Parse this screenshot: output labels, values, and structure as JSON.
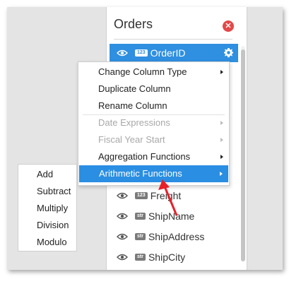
{
  "panel": {
    "title": "Orders",
    "close_icon": "close-icon",
    "fields": [
      {
        "type": "123",
        "name": "OrderID",
        "selected": true
      },
      {
        "type": "123",
        "name": "Freight",
        "selected": false
      },
      {
        "type": "str",
        "name": "ShipName",
        "selected": false
      },
      {
        "type": "str",
        "name": "ShipAddress",
        "selected": false
      },
      {
        "type": "str",
        "name": "ShipCity",
        "selected": false
      }
    ]
  },
  "context_menu": {
    "items": [
      {
        "label": "Change Column Type",
        "submenu": true,
        "disabled": false
      },
      {
        "label": "Duplicate Column",
        "submenu": false,
        "disabled": false
      },
      {
        "label": "Rename Column",
        "submenu": false,
        "disabled": false
      },
      {
        "label": "Date Expressions",
        "submenu": true,
        "disabled": true
      },
      {
        "label": "Fiscal Year Start",
        "submenu": true,
        "disabled": true
      },
      {
        "label": "Aggregation Functions",
        "submenu": true,
        "disabled": false
      },
      {
        "label": "Arithmetic Functions",
        "submenu": true,
        "disabled": false,
        "highlighted": true
      }
    ]
  },
  "arithmetic_submenu": {
    "items": [
      "Add",
      "Subtract",
      "Multiply",
      "Division",
      "Modulo"
    ]
  },
  "colors": {
    "selected_row": "#2f8fe0",
    "highlight_item": "#2a8ee2",
    "close_button": "#e44848",
    "annotation_arrow": "#e8202a"
  }
}
